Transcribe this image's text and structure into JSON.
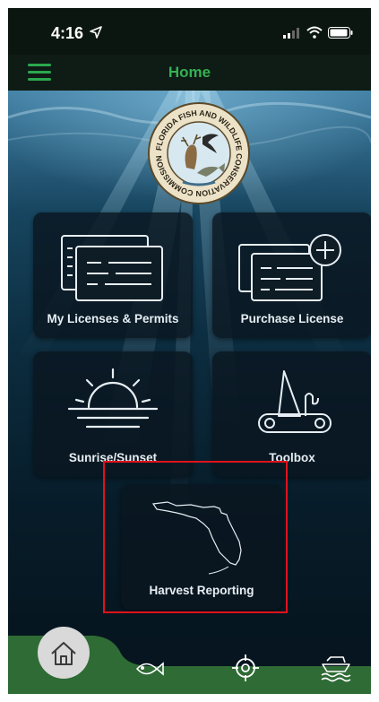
{
  "status_bar": {
    "time": "4:16",
    "icons": [
      "location-arrow-icon",
      "signal-icon",
      "wifi-icon",
      "battery-icon"
    ]
  },
  "header": {
    "title": "Home",
    "menu_icon": "hamburger-menu-icon"
  },
  "seal": {
    "text": "FLORIDA FISH AND WILDLIFE CONSERVATION COMMISSION"
  },
  "tiles": [
    {
      "label": "My Licenses & Permits",
      "icon": "license-card-icon"
    },
    {
      "label": "Purchase License",
      "icon": "add-license-icon"
    },
    {
      "label": "Sunrise/Sunset",
      "icon": "sunrise-icon"
    },
    {
      "label": "Toolbox",
      "icon": "pocket-knife-icon"
    },
    {
      "label": "Harvest Reporting",
      "icon": "florida-map-icon"
    }
  ],
  "bottom_tabs": [
    {
      "name": "home",
      "icon": "home-icon",
      "selected": true
    },
    {
      "name": "fishing",
      "icon": "fish-icon",
      "selected": false
    },
    {
      "name": "hunting",
      "icon": "crosshair-icon",
      "selected": false
    },
    {
      "name": "boating",
      "icon": "boat-icon",
      "selected": false
    }
  ],
  "colors": {
    "accent_green": "#35b052",
    "bottom_bar_green": "#2f6b35",
    "highlight_red": "#e0121c",
    "tile_background": "#0a1620"
  }
}
